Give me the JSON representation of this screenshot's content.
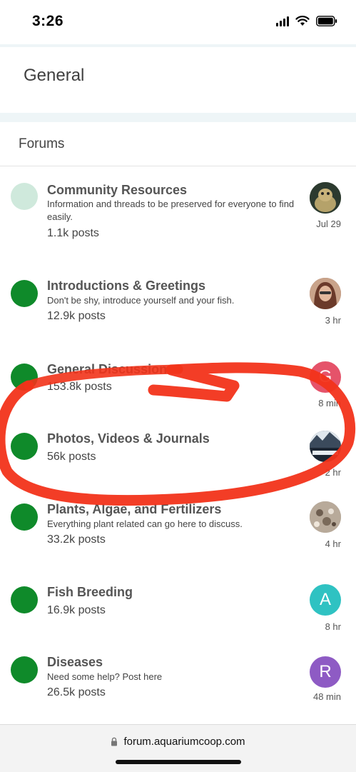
{
  "status_bar": {
    "time": "3:26"
  },
  "header": {
    "title": "General"
  },
  "forums_section": {
    "label": "Forums"
  },
  "forums": [
    {
      "title": "Community Resources",
      "description": "Information and threads to be preserved for everyone to find easily.",
      "posts": "1.1k posts",
      "last_activity": "Jul 29",
      "dot_color": "#cfe9dc",
      "avatar_letter": "",
      "avatar_color": "#4a5a3a"
    },
    {
      "title": "Introductions & Greetings",
      "description": "Don't be shy, introduce yourself and your fish.",
      "posts": "12.9k posts",
      "last_activity": "3 hr",
      "dot_color": "#0f8a2a",
      "avatar_letter": "",
      "avatar_color": "#8b5a45"
    },
    {
      "title": "General Discussion",
      "description": "",
      "posts": "153.8k posts",
      "last_activity": "8 min",
      "dot_color": "#0f8a2a",
      "avatar_letter": "G",
      "avatar_color": "#e5536a"
    },
    {
      "title": "Photos, Videos & Journals",
      "description": "",
      "posts": "56k posts",
      "last_activity": "2 hr",
      "dot_color": "#0f8a2a",
      "avatar_letter": "",
      "avatar_color": "#2e3a48"
    },
    {
      "title": "Plants, Algae, and Fertilizers",
      "description": "Everything plant related can go here to discuss.",
      "posts": "33.2k posts",
      "last_activity": "4 hr",
      "dot_color": "#0f8a2a",
      "avatar_letter": "",
      "avatar_color": "#9a8a7a"
    },
    {
      "title": "Fish Breeding",
      "description": "",
      "posts": "16.9k posts",
      "last_activity": "8 hr",
      "dot_color": "#0f8a2a",
      "avatar_letter": "A",
      "avatar_color": "#2fc2c2"
    },
    {
      "title": "Diseases",
      "description": "Need some help? Post here",
      "posts": "26.5k posts",
      "last_activity": "48 min",
      "dot_color": "#0f8a2a",
      "avatar_letter": "R",
      "avatar_color": "#8e5bc4"
    }
  ],
  "browser": {
    "url": "forum.aquariumcoop.com"
  },
  "colors": {
    "section_band": "#eef5f7",
    "annotation_red": "#f2331a"
  }
}
